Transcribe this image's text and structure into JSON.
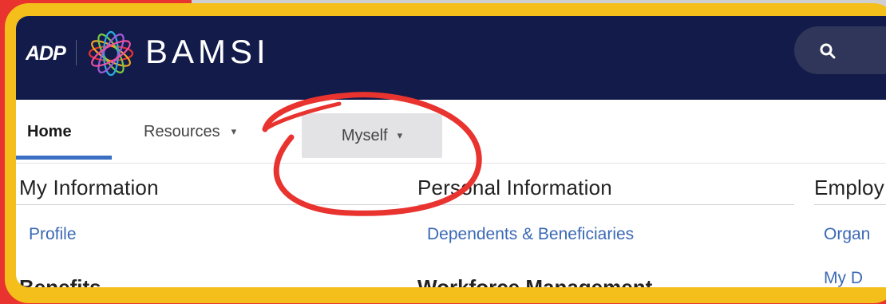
{
  "header": {
    "adp_logo_text": "ADP",
    "brand_name": "BAMSI",
    "search_icon": "search-icon"
  },
  "nav": {
    "tabs": [
      {
        "label": "Home",
        "active": true
      },
      {
        "label": "Resources",
        "dropdown": true
      },
      {
        "label": "Myself",
        "dropdown": true,
        "highlighted": true
      }
    ],
    "chevron": "▾"
  },
  "menu": {
    "columns": [
      {
        "title": "My Information",
        "links": [
          "Profile"
        ],
        "next_title": "Benefits"
      },
      {
        "title": "Personal Information",
        "links": [
          "Dependents & Beneficiaries"
        ],
        "next_title": "Workforce Management"
      },
      {
        "title": "Employ",
        "links": [
          "Organ",
          "My D"
        ]
      }
    ]
  },
  "colors": {
    "header_bg": "#121b4a",
    "frame": "#f5bf1b",
    "outer_bg": "#e8332f",
    "link": "#3b69b5",
    "annotation": "#e8332f"
  }
}
